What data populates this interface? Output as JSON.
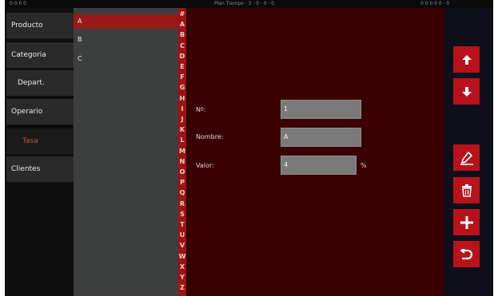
{
  "status_bar": {
    "left": "0 0 0 0",
    "middle": "Plan  Tiempo  · 3 · 0 · 0 · 0",
    "right": "0 0 0 0 0 · 0"
  },
  "menu": {
    "items": [
      {
        "label": "Producto"
      },
      {
        "label": "Categoria"
      },
      {
        "label": "Depart."
      },
      {
        "label": "Operario"
      },
      {
        "label": "Tasa"
      },
      {
        "label": "Clientes"
      }
    ]
  },
  "list": {
    "items": [
      "A",
      "B",
      "C"
    ],
    "selected": "A"
  },
  "alphabet": [
    "#",
    "A",
    "B",
    "C",
    "D",
    "E",
    "F",
    "G",
    "H",
    "I",
    "J",
    "K",
    "L",
    "M",
    "N",
    "O",
    "P",
    "Q",
    "R",
    "S",
    "T",
    "U",
    "V",
    "W",
    "X",
    "Y",
    "Z"
  ],
  "form": {
    "number_label": "Nº:",
    "number_value": "1",
    "name_label": "Nombre:",
    "name_value": "A",
    "value_label": "Valor:",
    "value_value": "4",
    "value_unit": "%"
  },
  "actions": [
    {
      "name": "arrow-up-icon"
    },
    {
      "name": "arrow-down-icon"
    },
    {
      "name": "edit-icon"
    },
    {
      "name": "trash-icon"
    },
    {
      "name": "plus-icon"
    },
    {
      "name": "undo-icon"
    }
  ],
  "colors": {
    "accent": "#b8121b",
    "panel": "#3a0101",
    "list_selected": "#9a1a1a"
  }
}
